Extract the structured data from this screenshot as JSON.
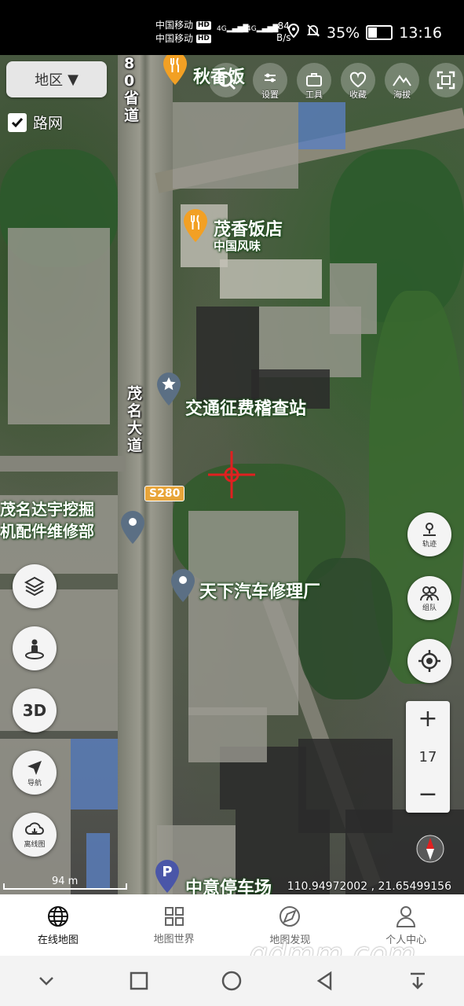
{
  "status_bar": {
    "carrier1": "中国移动",
    "carrier2": "中国移动",
    "hd": "HD",
    "signal1": "4G",
    "signal2": "4G",
    "net_speed_value": "84",
    "net_speed_unit": "B/s",
    "battery_percent": "35%",
    "battery_level": 0.35,
    "time": "13:16"
  },
  "map_controls": {
    "region_button": "地区",
    "road_network_label": "路网",
    "road_network_checked": true,
    "top_tools": [
      {
        "icon": "search-icon",
        "label": ""
      },
      {
        "icon": "settings-icon",
        "label": "设置"
      },
      {
        "icon": "toolbox-icon",
        "label": "工具"
      },
      {
        "icon": "heart-icon",
        "label": "收藏"
      },
      {
        "icon": "mountain-icon",
        "label": "海拔"
      },
      {
        "icon": "fullscreen-icon",
        "label": ""
      }
    ],
    "left_fabs": [
      {
        "icon": "layers-icon",
        "label": ""
      },
      {
        "icon": "street-view-icon",
        "label": ""
      },
      {
        "icon": "3d-icon",
        "label": "3D"
      },
      {
        "icon": "navigation-arrow-icon",
        "label": "导航"
      },
      {
        "icon": "offline-map-icon",
        "label": "离线图"
      }
    ],
    "right_fabs": [
      {
        "icon": "track-icon",
        "label": "轨迹"
      },
      {
        "icon": "team-icon",
        "label": "组队"
      },
      {
        "icon": "locate-icon",
        "label": ""
      }
    ],
    "zoom_in": "+",
    "zoom_level": "17",
    "zoom_out": "−"
  },
  "map_labels": {
    "road_provincial": "80省道",
    "road_main": "茂名大道",
    "shield": "S280",
    "poi_restaurant_top": "秋香饭",
    "poi_restaurant": "茂香饭店",
    "poi_restaurant_sub": "中国风味",
    "poi_toll": "交通征费稽查站",
    "poi_repair1_line1": "茂名达宇挖掘",
    "poi_repair1_line2": "机配件维修部",
    "poi_repair2": "天下汽车修理厂",
    "poi_parking": "中意停车场"
  },
  "scale_bar": "94 m",
  "coordinates": "110.94972002 , 21.65499156",
  "tabs": [
    {
      "label": "在线地图",
      "icon": "globe-icon",
      "active": true
    },
    {
      "label": "地图世界",
      "icon": "grid-icon",
      "active": false
    },
    {
      "label": "地图发现",
      "icon": "discover-icon",
      "active": false
    },
    {
      "label": "个人中心",
      "icon": "person-icon",
      "active": false
    }
  ],
  "watermark": "gdmm.com",
  "colors": {
    "poi_orange": "#f2a024",
    "poi_grey": "#5b6f84",
    "crosshair": "#e02020",
    "parking_blue": "#4a56a8"
  }
}
